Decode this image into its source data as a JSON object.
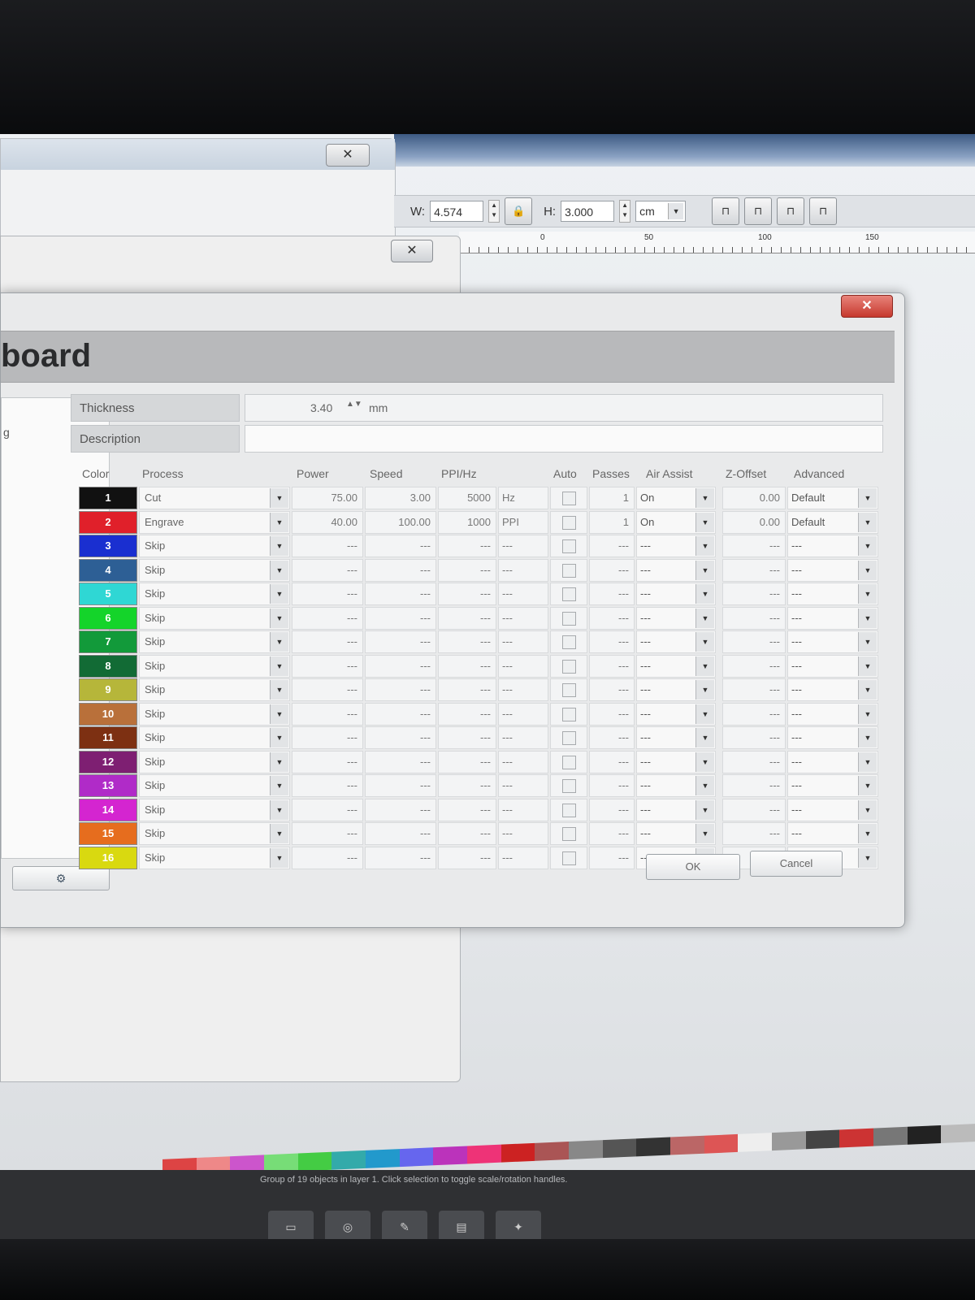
{
  "toolbar": {
    "width_label": "W:",
    "width_value": "4.574",
    "height_label": "H:",
    "height_value": "3.000",
    "unit": "cm",
    "lock_icon": "lock-icon",
    "align_buttons": [
      "align-icon",
      "align-icon",
      "align-icon",
      "align-icon"
    ]
  },
  "ruler": {
    "ticks": [
      "0",
      "50",
      "100",
      "150"
    ]
  },
  "dialog": {
    "title": "board",
    "left_panel_text": "g",
    "thickness_label": "Thickness",
    "thickness_value": "3.40",
    "thickness_unit": "mm",
    "description_label": "Description",
    "description_value": "",
    "ok_label": "OK",
    "cancel_label": "Cancel"
  },
  "table": {
    "headers": {
      "color": "Color",
      "process": "Process",
      "power": "Power",
      "speed": "Speed",
      "ppi": "PPI/Hz",
      "auto": "Auto",
      "passes": "Passes",
      "air": "Air Assist",
      "zoffset": "Z-Offset",
      "advanced": "Advanced"
    },
    "rows": [
      {
        "num": "1",
        "color": "#111111",
        "process": "Cut",
        "power": "75.00",
        "speed": "3.00",
        "ppi": "5000",
        "unit": "Hz",
        "passes": "1",
        "air": "On",
        "z": "0.00",
        "adv": "Default"
      },
      {
        "num": "2",
        "color": "#e0202a",
        "process": "Engrave",
        "power": "40.00",
        "speed": "100.00",
        "ppi": "1000",
        "unit": "PPI",
        "passes": "1",
        "air": "On",
        "z": "0.00",
        "adv": "Default"
      },
      {
        "num": "3",
        "color": "#1a2fd0",
        "process": "Skip",
        "power": "---",
        "speed": "---",
        "ppi": "---",
        "unit": "---",
        "passes": "---",
        "air": "---",
        "z": "---",
        "adv": "---"
      },
      {
        "num": "4",
        "color": "#2d5f95",
        "process": "Skip",
        "power": "---",
        "speed": "---",
        "ppi": "---",
        "unit": "---",
        "passes": "---",
        "air": "---",
        "z": "---",
        "adv": "---"
      },
      {
        "num": "5",
        "color": "#2fd7d4",
        "process": "Skip",
        "power": "---",
        "speed": "---",
        "ppi": "---",
        "unit": "---",
        "passes": "---",
        "air": "---",
        "z": "---",
        "adv": "---"
      },
      {
        "num": "6",
        "color": "#14d42a",
        "process": "Skip",
        "power": "---",
        "speed": "---",
        "ppi": "---",
        "unit": "---",
        "passes": "---",
        "air": "---",
        "z": "---",
        "adv": "---"
      },
      {
        "num": "7",
        "color": "#129a3a",
        "process": "Skip",
        "power": "---",
        "speed": "---",
        "ppi": "---",
        "unit": "---",
        "passes": "---",
        "air": "---",
        "z": "---",
        "adv": "---"
      },
      {
        "num": "8",
        "color": "#126b35",
        "process": "Skip",
        "power": "---",
        "speed": "---",
        "ppi": "---",
        "unit": "---",
        "passes": "---",
        "air": "---",
        "z": "---",
        "adv": "---"
      },
      {
        "num": "9",
        "color": "#b6b63a",
        "process": "Skip",
        "power": "---",
        "speed": "---",
        "ppi": "---",
        "unit": "---",
        "passes": "---",
        "air": "---",
        "z": "---",
        "adv": "---"
      },
      {
        "num": "10",
        "color": "#b9703a",
        "process": "Skip",
        "power": "---",
        "speed": "---",
        "ppi": "---",
        "unit": "---",
        "passes": "---",
        "air": "---",
        "z": "---",
        "adv": "---"
      },
      {
        "num": "11",
        "color": "#7d3012",
        "process": "Skip",
        "power": "---",
        "speed": "---",
        "ppi": "---",
        "unit": "---",
        "passes": "---",
        "air": "---",
        "z": "---",
        "adv": "---"
      },
      {
        "num": "12",
        "color": "#7e1f72",
        "process": "Skip",
        "power": "---",
        "speed": "---",
        "ppi": "---",
        "unit": "---",
        "passes": "---",
        "air": "---",
        "z": "---",
        "adv": "---"
      },
      {
        "num": "13",
        "color": "#b02bc8",
        "process": "Skip",
        "power": "---",
        "speed": "---",
        "ppi": "---",
        "unit": "---",
        "passes": "---",
        "air": "---",
        "z": "---",
        "adv": "---"
      },
      {
        "num": "14",
        "color": "#d425d0",
        "process": "Skip",
        "power": "---",
        "speed": "---",
        "ppi": "---",
        "unit": "---",
        "passes": "---",
        "air": "---",
        "z": "---",
        "adv": "---"
      },
      {
        "num": "15",
        "color": "#e66d1e",
        "process": "Skip",
        "power": "---",
        "speed": "---",
        "ppi": "---",
        "unit": "---",
        "passes": "---",
        "air": "---",
        "z": "---",
        "adv": "---"
      },
      {
        "num": "16",
        "color": "#d9d910",
        "process": "Skip",
        "power": "---",
        "speed": "---",
        "ppi": "---",
        "unit": "---",
        "passes": "---",
        "air": "---",
        "z": "---",
        "adv": "---"
      }
    ]
  },
  "palette": [
    "#d44",
    "#e88",
    "#c5c",
    "#7d7",
    "#4c4",
    "#3aa",
    "#29c",
    "#66e",
    "#b3b",
    "#e37",
    "#c22",
    "#a55",
    "#888",
    "#555",
    "#333",
    "#b66",
    "#d55",
    "#eee",
    "#999",
    "#444",
    "#c33",
    "#777",
    "#222",
    "#bbb"
  ],
  "statusbar": {
    "text": "Group of 19 objects in layer 1. Click selection to toggle scale/rotation handles."
  },
  "taskbar_icons": [
    "folder-icon",
    "browser-icon",
    "inkscape-icon",
    "file-icon",
    "laser-icon"
  ]
}
